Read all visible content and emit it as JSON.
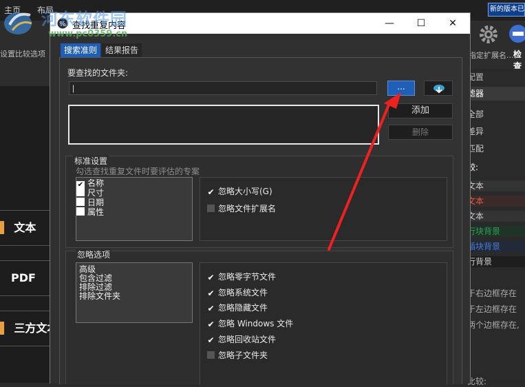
{
  "app": {
    "menu": [
      "主页",
      "布局"
    ],
    "new_version": "新的版本已",
    "toolbar_left_label": "设置比较选项",
    "toolbar_right_label": "指定扩展名...",
    "toolbar_check_label": "检查",
    "left_items": [
      "文本",
      "PDF",
      "三方文本"
    ],
    "right_panel": {
      "header": "配置",
      "filter_tab": "滤器",
      "rows": [
        "全部",
        "差异",
        "匹配"
      ],
      "section": "较:",
      "colored_rows": [
        {
          "text": "文本",
          "color": "#cfcfcf",
          "bg": "#333333"
        },
        {
          "text": "文本",
          "color": "#e05a4a",
          "bg": "#3a2a2a"
        },
        {
          "text": "文本",
          "color": "#cfcfcf",
          "bg": "#333333"
        },
        {
          "text": "行块背景",
          "color": "#2e9e5a",
          "bg": "#1f3328"
        },
        {
          "text": "插块背景",
          "color": "#4a7ad0",
          "bg": "#222a3a"
        },
        {
          "text": "行背景",
          "color": "#cfcfcf",
          "bg": "#1e1e1e"
        }
      ],
      "notes": [
        "于右边框存在",
        "于左边框存在",
        "两个边框存在,"
      ],
      "footer": "比较:"
    }
  },
  "watermark": {
    "title": "河东软件园",
    "url": "www.pc0359.cn"
  },
  "dialog": {
    "title": "查找重复内容",
    "controls": {
      "minimize": "—",
      "maximize": "☐",
      "close": "✕"
    },
    "tabs": [
      "搜索准则",
      "结果报告"
    ],
    "folder_label": "要查找的文件夹:",
    "folder_value": "|",
    "browse_label": "...",
    "add_label": "添加",
    "delete_label": "删除",
    "standard_settings": {
      "title": "标准设置",
      "hint": "勾选查找重复文件时要评估的专案",
      "criteria": [
        {
          "label": "名称",
          "checked": true
        },
        {
          "label": "尺寸",
          "checked": false
        },
        {
          "label": "日期",
          "checked": false
        },
        {
          "label": "属性",
          "checked": false
        }
      ],
      "options": [
        {
          "label": "忽略大小写(G)",
          "checked": true
        },
        {
          "label": "忽略文件扩展名",
          "checked": false
        }
      ]
    },
    "ignore_options": {
      "title": "忽略选项",
      "list": [
        "高级",
        "包含过滤",
        "排除过滤",
        "排除文件夹"
      ],
      "options": [
        {
          "label": "忽略零字节文件",
          "checked": true
        },
        {
          "label": "忽略系统文件",
          "checked": true
        },
        {
          "label": "忽略隐藏文件",
          "checked": true
        },
        {
          "label": "忽略 Windows 文件",
          "checked": true
        },
        {
          "label": "忽略回收站文件",
          "checked": true
        },
        {
          "label": "忽略子文件夹",
          "checked": false
        }
      ]
    }
  },
  "colors": {
    "accent": "#1f5fb8",
    "annotation_arrow": "#ee2020"
  }
}
